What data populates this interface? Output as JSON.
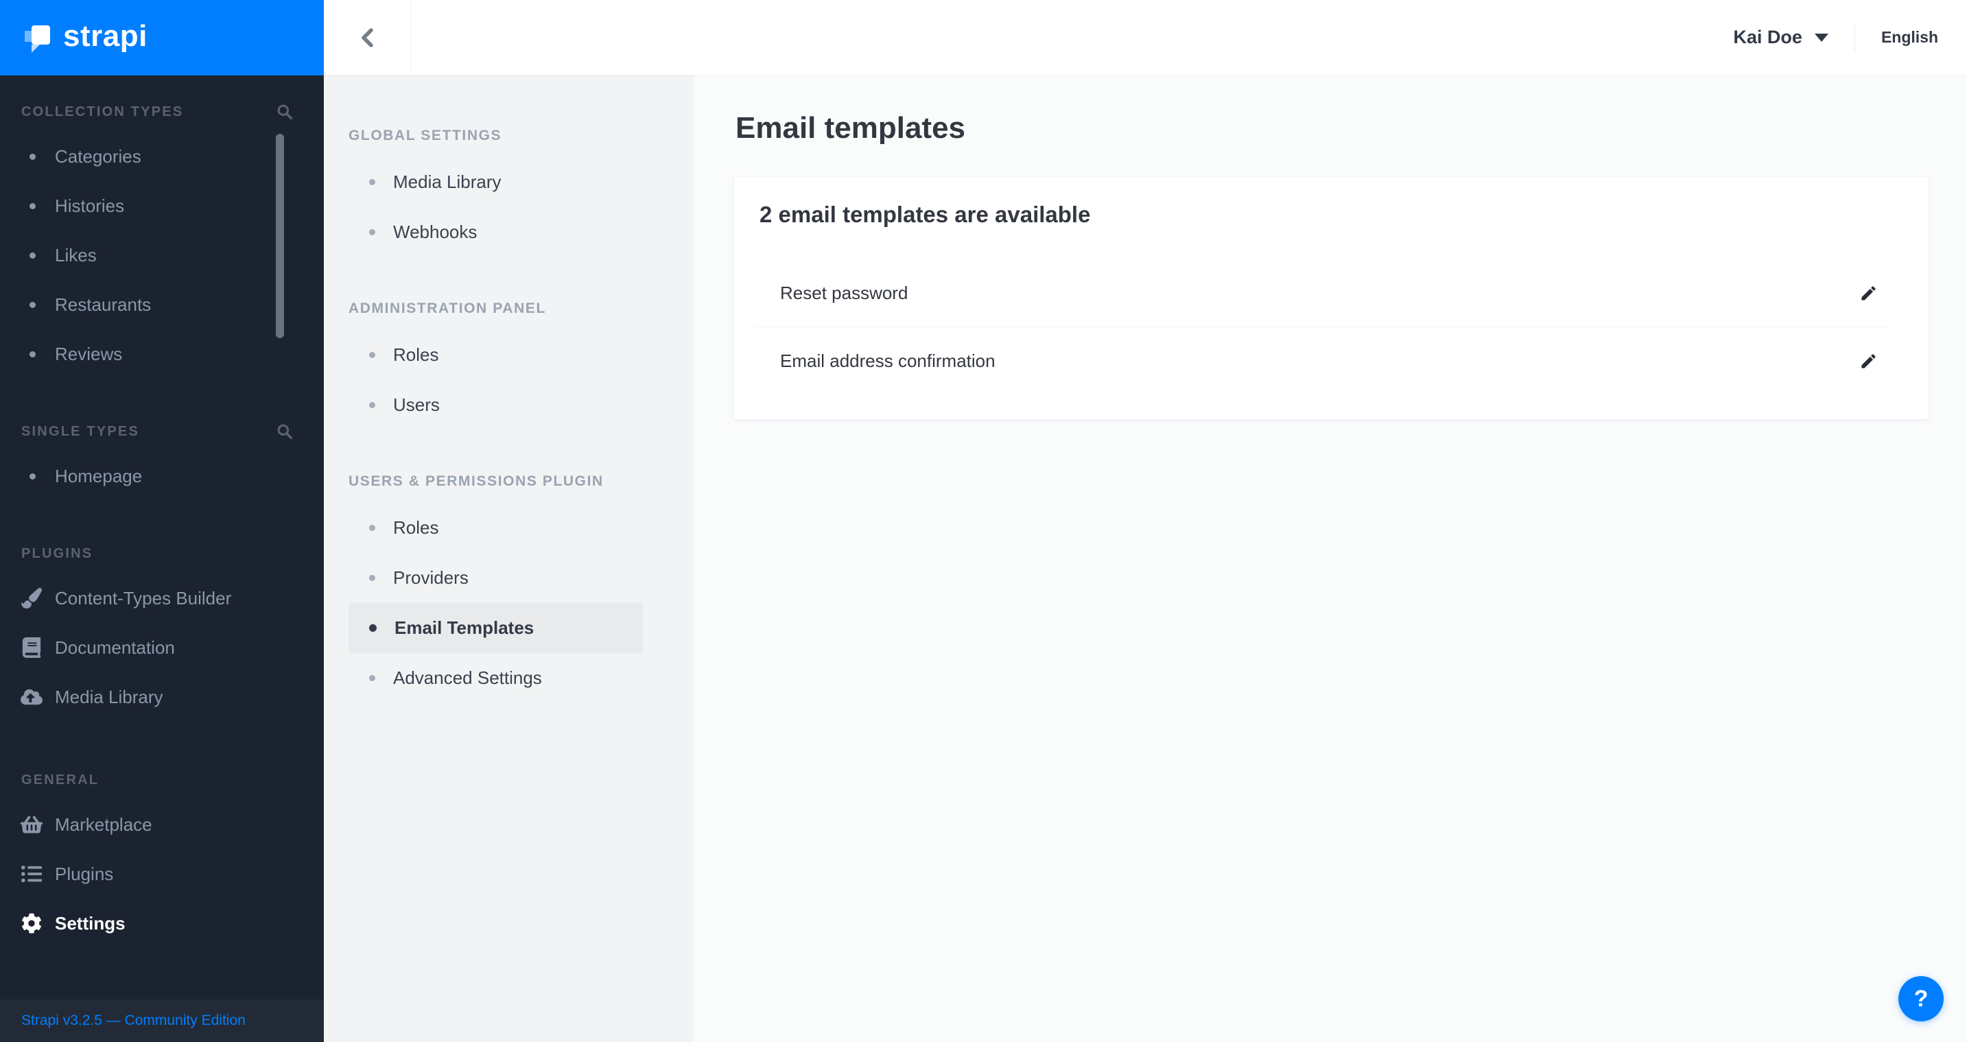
{
  "brand": {
    "name": "strapi",
    "accent_color": "#007eff"
  },
  "sidebar": {
    "sections": [
      {
        "label": "COLLECTION TYPES",
        "has_search": true,
        "items": [
          {
            "label": "Categories"
          },
          {
            "label": "Histories"
          },
          {
            "label": "Likes"
          },
          {
            "label": "Restaurants"
          },
          {
            "label": "Reviews"
          }
        ]
      },
      {
        "label": "SINGLE TYPES",
        "has_search": true,
        "items": [
          {
            "label": "Homepage"
          }
        ]
      },
      {
        "label": "PLUGINS",
        "has_search": false,
        "items": [
          {
            "label": "Content-Types Builder",
            "icon": "paintbrush-icon"
          },
          {
            "label": "Documentation",
            "icon": "book-icon"
          },
          {
            "label": "Media Library",
            "icon": "cloud-upload-icon"
          }
        ]
      },
      {
        "label": "GENERAL",
        "has_search": false,
        "items": [
          {
            "label": "Marketplace",
            "icon": "basket-icon"
          },
          {
            "label": "Plugins",
            "icon": "list-icon"
          },
          {
            "label": "Settings",
            "icon": "gear-icon",
            "active": true
          }
        ]
      }
    ],
    "footer_link": "Strapi v3.2.5 — Community Edition"
  },
  "header": {
    "user_name": "Kai Doe",
    "language": "English"
  },
  "settings_nav": {
    "sections": [
      {
        "label": "GLOBAL SETTINGS",
        "items": [
          {
            "label": "Media Library"
          },
          {
            "label": "Webhooks"
          }
        ]
      },
      {
        "label": "ADMINISTRATION PANEL",
        "items": [
          {
            "label": "Roles"
          },
          {
            "label": "Users"
          }
        ]
      },
      {
        "label": "USERS & PERMISSIONS PLUGIN",
        "items": [
          {
            "label": "Roles"
          },
          {
            "label": "Providers"
          },
          {
            "label": "Email Templates",
            "active": true
          },
          {
            "label": "Advanced Settings"
          }
        ]
      }
    ]
  },
  "main": {
    "title": "Email templates",
    "card": {
      "heading": "2 email templates are available",
      "rows": [
        {
          "label": "Reset password"
        },
        {
          "label": "Email address confirmation"
        }
      ]
    },
    "help_label": "?"
  },
  "colors": {
    "accent": "#007eff",
    "sidebar_bg": "#1c2330",
    "subnav_bg": "#f2f3f4",
    "subnav_active_bg": "#e9eaeb",
    "text_dark": "#333740",
    "sidebar_item_text": "#8c96a9"
  }
}
